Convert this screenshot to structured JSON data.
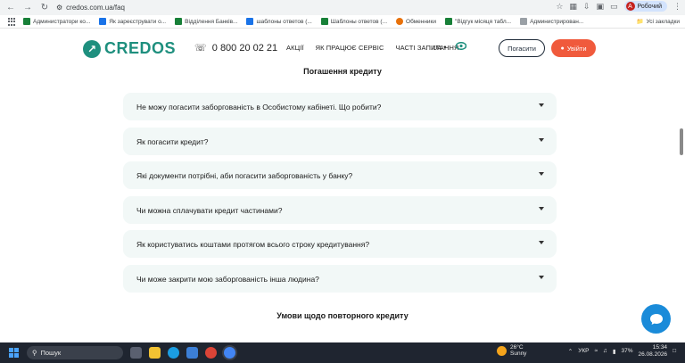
{
  "browser": {
    "url": "credos.com.ua/faq",
    "profile_label": "Робочий",
    "profile_initial": "A",
    "bookmarks": [
      {
        "label": "Администратори ко...",
        "color": "#188038"
      },
      {
        "label": "Як зареєструвати о...",
        "color": "#1a73e8"
      },
      {
        "label": "Відділення Банків...",
        "color": "#188038"
      },
      {
        "label": "шаблоны ответов (...",
        "color": "#1a73e8"
      },
      {
        "label": "Шаблоны ответов (...",
        "color": "#188038"
      },
      {
        "label": "Обменники",
        "color": "#e8710a"
      },
      {
        "label": "\"Відгук місяця табл...",
        "color": "#188038"
      },
      {
        "label": "Администрирован...",
        "color": "#9aa0a6"
      }
    ],
    "all_bookmarks_label": "Усі закладки"
  },
  "header": {
    "logo_text": "CREDOS",
    "phone": "0 800 20 02 21",
    "menu": [
      "АКЦІЇ",
      "ЯК ПРАЦЮЄ СЕРВІС",
      "ЧАСТІ ЗАПИТАННЯ"
    ],
    "language": "UA",
    "repay_button": "Погасити",
    "login_button": "Увійти",
    "accent_color": "#1e8f7e",
    "login_color": "#f05a3c"
  },
  "content": {
    "section_title": "Погашення кредиту",
    "faq_items": [
      "Не можу погасити заборгованість в Особистому кабінеті. Що робити?",
      "Як погасити кредит?",
      "Які документи потрібні, аби погасити заборгованість у банку?",
      "Чи можна сплачувати кредит частинами?",
      "Як користуватись коштами протягом всього строку кредитування?",
      "Чи може закрити мою заборгованість інша людина?"
    ],
    "next_section_title": "Умови щодо повторного кредиту"
  },
  "taskbar": {
    "search_placeholder": "Пошук",
    "weather_temp": "26°C",
    "weather_desc": "Sunny",
    "lang": "УКР",
    "battery": "37%",
    "time": "15:34",
    "date": "26.08.2026"
  }
}
